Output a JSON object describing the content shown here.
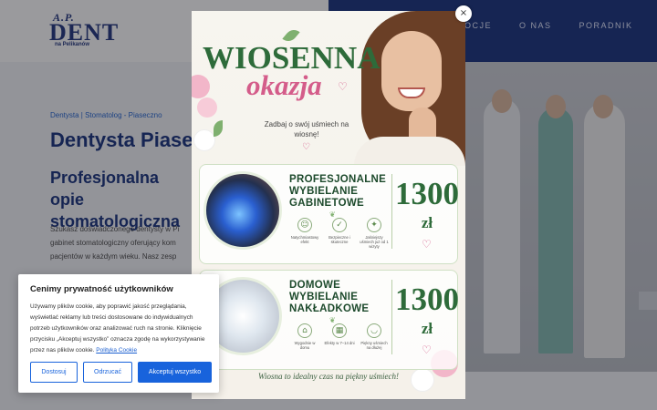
{
  "header": {
    "logo": {
      "top": "A.P.",
      "main": "DENT",
      "sub": "na Pelikanów"
    },
    "nav": [
      "MOCJE",
      "O NAS",
      "PORADNIK"
    ]
  },
  "hero": {
    "breadcrumb": "Dentysta | Stomatolog - Piaseczno",
    "title": "Dentysta Piase",
    "subtitle": "Profesjonalna opie stomatologiczna",
    "intro": "Szukasz doświadczonego dentysty w Pi gabinet stomatologiczny oferujący kom pacjentów w każdym wieku. Nasz zesp"
  },
  "promo": {
    "close_label": "×",
    "title": "WIOSENNA",
    "subtitle": "okazja",
    "tagline": "Zadbaj o swój uśmiech na wiosnę!",
    "offer1": {
      "title": "PROFESJONALNE WYBIELANIE GABINETOWE",
      "price": "1300",
      "currency": "zł",
      "features": [
        {
          "icon": "tooth-icon",
          "glyph": "☺",
          "label": "Natychmiastowy efekt"
        },
        {
          "icon": "shield-icon",
          "glyph": "✓",
          "label": "Bezpieczne i skuteczne"
        },
        {
          "icon": "sparkle-icon",
          "glyph": "✦",
          "label": "Jaśniejszy uśmiech już od 1 wizyty"
        }
      ]
    },
    "offer2": {
      "title": "DOMOWE WYBIELANIE NAKŁADKOWE",
      "price": "1300",
      "currency": "zł",
      "features": [
        {
          "icon": "home-icon",
          "glyph": "⌂",
          "label": "Wygodnie w domu"
        },
        {
          "icon": "calendar-icon",
          "glyph": "▦",
          "label": "Efekty w 7–14 dni"
        },
        {
          "icon": "smile-icon",
          "glyph": "◡",
          "label": "Piękny uśmiech na dłużej"
        }
      ]
    },
    "footer": "Wiosna to idealny czas na piękny uśmiech!"
  },
  "cookie": {
    "title": "Cenimy prywatność użytkowników",
    "text": "Używamy plików cookie, aby poprawić jakość przeglądania, wyświetlać reklamy lub treści dostosowane do indywidualnych potrzeb użytkowników oraz analizować ruch na stronie. Kliknięcie przycisku „Akceptuj wszystko” oznacza zgodę na wykorzystywanie przez nas plików cookie.",
    "link": "Polityka Cookie",
    "customize": "Dostosuj",
    "reject": "Odrzucać",
    "accept": "Akceptuj wszystko"
  },
  "colors": {
    "brand": "#0f2a78",
    "accent": "#1863dc",
    "promo_green": "#2e6b3a",
    "promo_pink": "#d45c8a"
  }
}
